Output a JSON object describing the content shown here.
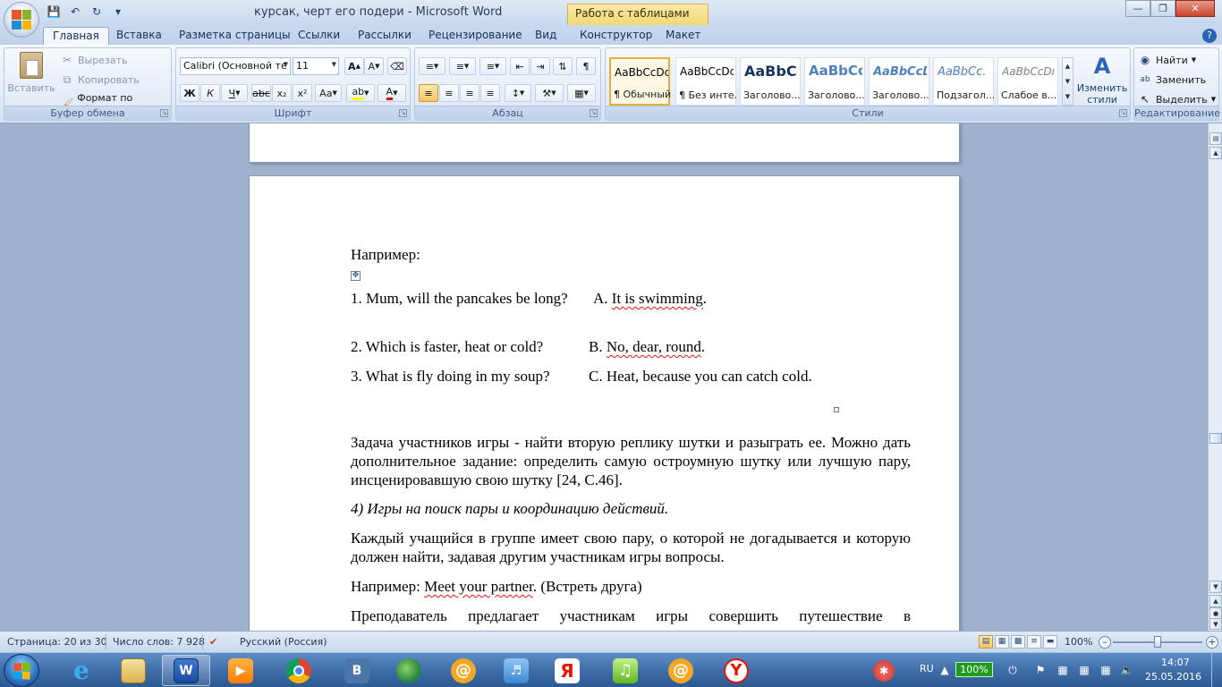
{
  "window": {
    "title": "курсак, черт его подери - Microsoft Word",
    "context_tab": "Работа с таблицами"
  },
  "tabs": [
    "Главная",
    "Вставка",
    "Разметка страницы",
    "Ссылки",
    "Рассылки",
    "Рецензирование",
    "Вид",
    "Конструктор",
    "Макет"
  ],
  "ribbon": {
    "clipboard": {
      "label": "Буфер обмена",
      "paste": "Вставить",
      "cut": "Вырезать",
      "copy": "Копировать",
      "format_painter": "Формат по образцу"
    },
    "font": {
      "label": "Шрифт",
      "font_name": "Calibri (Основной те",
      "font_size": "11",
      "bold": "Ж",
      "italic": "К",
      "underline": "Ч",
      "strike": "abc",
      "sub": "x₂",
      "sup": "x²",
      "case": "Aa",
      "grow": "A",
      "shrink": "A"
    },
    "paragraph": {
      "label": "Абзац"
    },
    "styles": {
      "label": "Стили",
      "change_styles": "Изменить стили",
      "items": [
        {
          "sample": "AaBbCcDc",
          "name": "¶ Обычный"
        },
        {
          "sample": "AaBbCcDc",
          "name": "¶ Без инте..."
        },
        {
          "sample": "AaBbC(",
          "name": "Заголово..."
        },
        {
          "sample": "AaBbCc",
          "name": "Заголово..."
        },
        {
          "sample": "AaBbCcD",
          "name": "Заголово..."
        },
        {
          "sample": "AaBbCc.",
          "name": "Подзагол..."
        },
        {
          "sample": "AaBbCcDı",
          "name": "Слабое в..."
        }
      ]
    },
    "editing": {
      "label": "Редактирование",
      "find": "Найти",
      "replace": "Заменить",
      "select": "Выделить"
    }
  },
  "document": {
    "example_label": "Например:",
    "table": [
      {
        "left": "1.  Mum,  will  the  pancakes  be long?",
        "right_prefix": "A. ",
        "right_squig": "It is swimming",
        "right_suffix": "."
      },
      {
        "left": "2. Which is faster, heat or cold?",
        "right_prefix": "B. ",
        "right_squig": "No, dear, round",
        "right_suffix": "."
      },
      {
        "left": "3. What is fly doing in my soup?",
        "right_prefix": "C.  Heat,  because  you  can  catch cold.",
        "right_squig": "",
        "right_suffix": ""
      }
    ],
    "para1": "Задача участников игры - найти вторую реплику шутки и разыграть ее. Можно дать дополнительное задание: определить самую остроумную шутку или лучшую пару, инсценировавшую свою шутку [24, С.46].",
    "heading4": "4) Игры на поиск пары и координацию действий.",
    "para2": "Каждый учащийся в группе имеет свою пару, о которой не догадывается и которую должен найти, задавая другим участникам игры вопросы.",
    "para3_prefix": "Например: ",
    "para3_squig": "Meet your partner",
    "para3_suffix": ". (Встреть друга)",
    "para4": "Преподаватель предлагает участникам игры совершить путешествие в"
  },
  "statusbar": {
    "page": "Страница: 20 из 30",
    "words": "Число слов: 7 928",
    "language": "Русский (Россия)",
    "zoom": "100%"
  },
  "taskbar": {
    "lang": "RU",
    "battery": "100%",
    "time": "14:07",
    "date": "25.05.2016"
  }
}
